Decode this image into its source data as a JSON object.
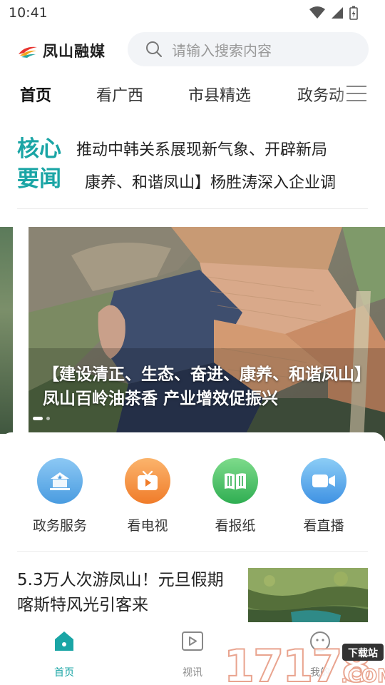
{
  "status_bar": {
    "time": "10:41"
  },
  "header": {
    "app_name": "凤山融媒",
    "search": {
      "placeholder": "请输入搜索内容"
    }
  },
  "tabs": [
    {
      "label": "首页",
      "active": true
    },
    {
      "label": "看广西",
      "active": false
    },
    {
      "label": "市县精选",
      "active": false
    },
    {
      "label": "政务动",
      "active": false
    }
  ],
  "core_news": {
    "label": "核心要闻",
    "headlines": [
      "推动中韩关系展现新气象、开辟新局",
      "康养、和谐凤山】杨胜涛深入企业调"
    ]
  },
  "banner": {
    "caption": "【建设清正、生态、奋进、康养、和谐凤山】凤山百岭油茶香 产业增效促振兴",
    "slide_count": 2,
    "active_slide": 0
  },
  "quick_menu": [
    {
      "label": "政务服务",
      "icon": "government-building-icon",
      "color": "#5aa8e6"
    },
    {
      "label": "看电视",
      "icon": "tv-icon",
      "color": "#f5923a"
    },
    {
      "label": "看报纸",
      "icon": "newspaper-icon",
      "color": "#3fbf64"
    },
    {
      "label": "看直播",
      "icon": "live-camera-icon",
      "color": "#3f9fe6"
    }
  ],
  "article": {
    "title": "5.3万人次游凤山！元旦假期喀斯特风光引客来"
  },
  "bottom_nav": [
    {
      "label": "首页",
      "icon": "home-icon",
      "active": true
    },
    {
      "label": "视讯",
      "icon": "video-play-icon",
      "active": false
    },
    {
      "label": "我的",
      "icon": "user-icon",
      "active": false
    }
  ],
  "watermark": {
    "text": "17178",
    "suffix": ".COM",
    "badge": "下载站"
  },
  "colors": {
    "accent": "#1aa5a5",
    "text": "#222222",
    "muted": "#999999"
  }
}
